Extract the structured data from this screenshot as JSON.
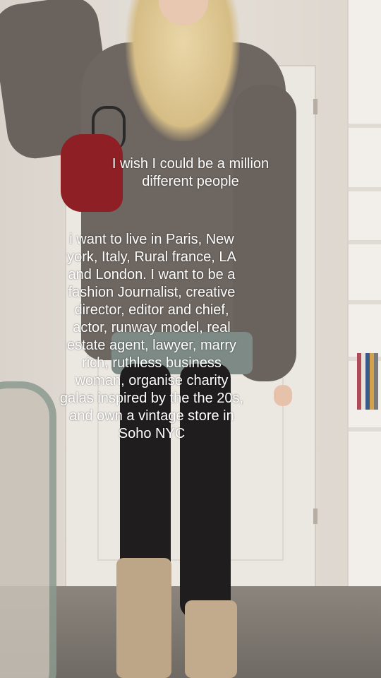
{
  "caption": {
    "line1": "I wish I could be a million\ndifferent people",
    "line2": "i want to live in Paris, New\nyork, Italy, Rural france, LA\nand London. I want to be a\nfashion Journalist, creative\ndirector, editor and chief,\nactor, runway model, real\nestate agent, lawyer, marry\nrich, ruthless business\nwoman, organise charity\ngalas inspired by the the 20s,\nand own a vintage store in\nSoho NYC"
  }
}
